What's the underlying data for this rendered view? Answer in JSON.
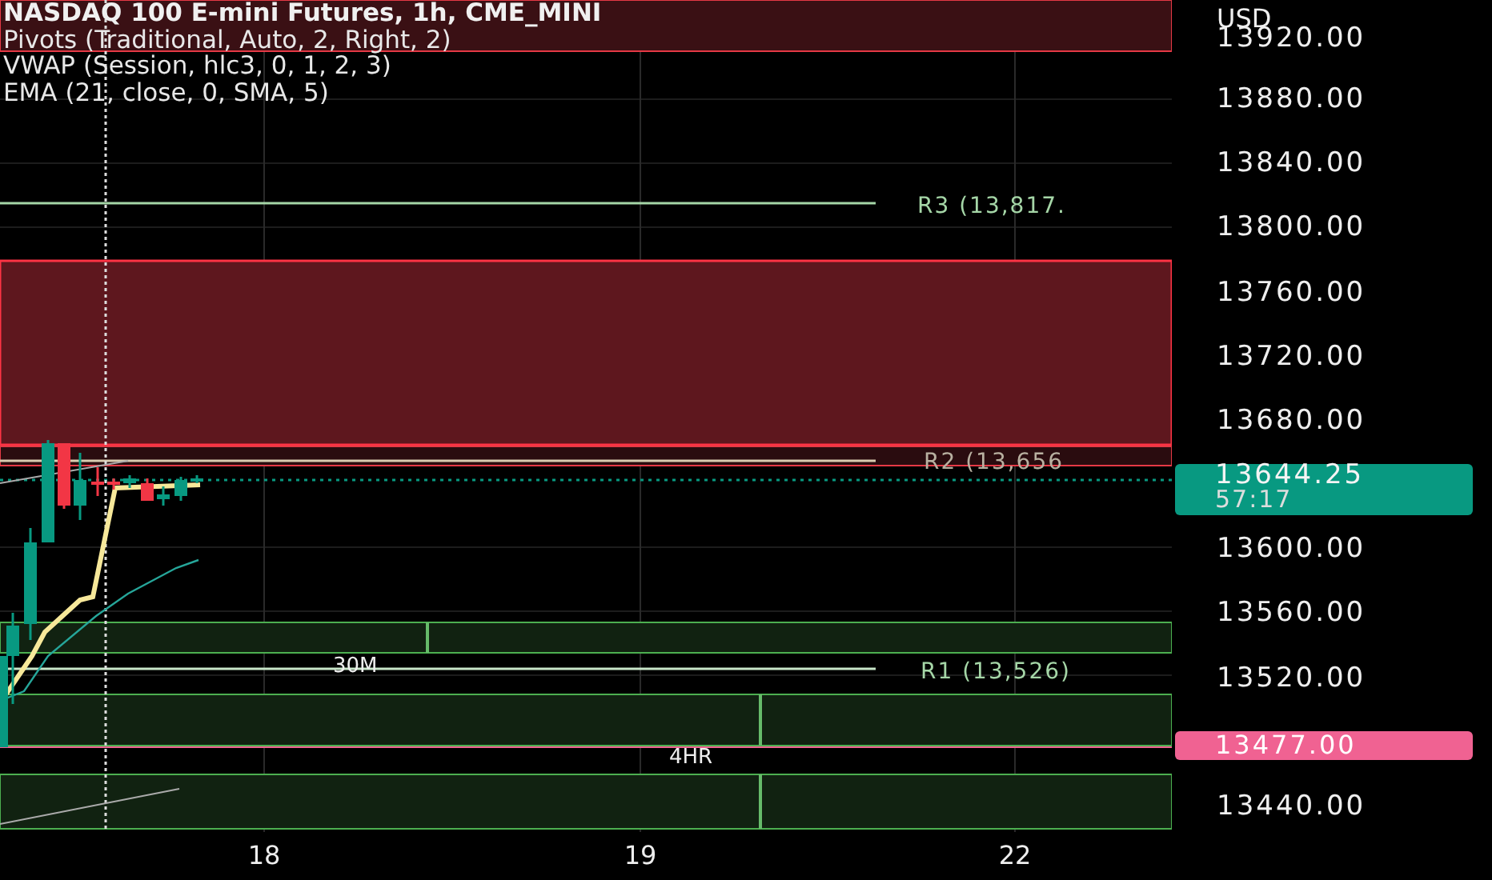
{
  "legend": {
    "title": "NASDAQ 100 E-mini Futures, 1h, CME_MINI",
    "indicators": [
      "Pivots (Traditional, Auto, 2, Right, 2)",
      "VWAP (Session, hlc3, 0, 1, 2, 3)",
      "EMA (21, close, 0, SMA, 5)"
    ]
  },
  "pivot_labels": [
    {
      "text": "R3 (13,817.",
      "kind": "r3"
    },
    {
      "text": "R2 (13,656",
      "kind": "r2"
    },
    {
      "text": "R1 (13,526)",
      "kind": "r1"
    }
  ],
  "zone_labels": [
    {
      "text": "30M",
      "kind": "m30"
    },
    {
      "text": "4HR",
      "kind": "h4"
    }
  ],
  "price_axis": {
    "currency": "USD",
    "ticks": [
      "13920.00",
      "13880.00",
      "13840.00",
      "13800.00",
      "13760.00",
      "13720.00",
      "13680.00",
      "13600.00",
      "13560.00",
      "13520.00",
      "13440.00"
    ],
    "last_price": {
      "price": "13644.25",
      "countdown": "57:17",
      "color": "#089981"
    },
    "marker": {
      "price": "13477.00",
      "color": "#f06292"
    }
  },
  "time_axis": [
    "18",
    "19",
    "22"
  ]
}
